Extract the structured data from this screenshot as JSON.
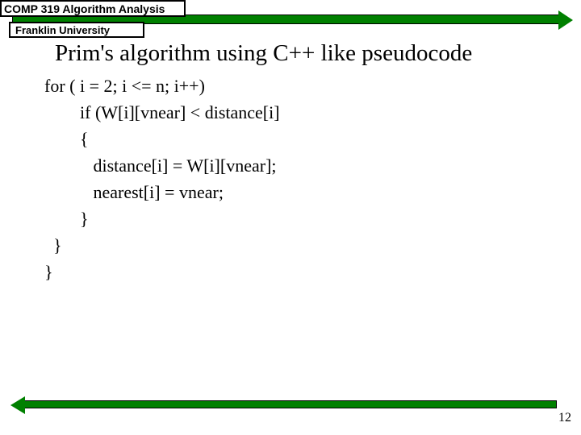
{
  "header": {
    "course": "COMP 319 Algorithm Analysis",
    "university": "Franklin University"
  },
  "title": "Prim's algorithm using C++ like  pseudocode",
  "code": {
    "line1": "for ( i = 2; i <= n; i++)",
    "line2": "        if (W[i][vnear] < distance[i]",
    "line3": "        {",
    "line4": "           distance[i] = W[i][vnear];",
    "line5": "           nearest[i] = vnear;",
    "line6": "        }",
    "line7": "  }",
    "line8": "}"
  },
  "page_number": "12"
}
